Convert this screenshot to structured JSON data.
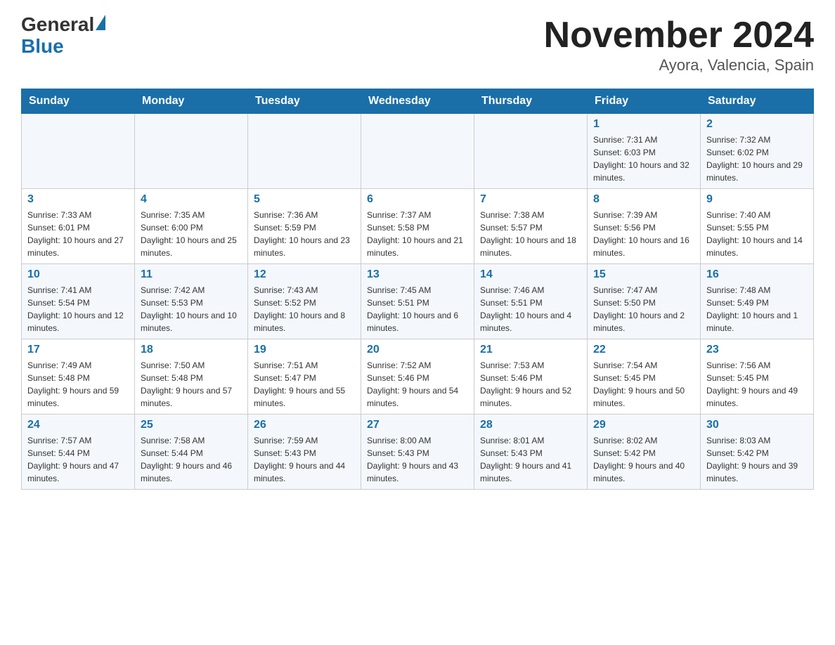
{
  "header": {
    "logo_general": "General",
    "logo_blue": "Blue",
    "title": "November 2024",
    "location": "Ayora, Valencia, Spain"
  },
  "days_of_week": [
    "Sunday",
    "Monday",
    "Tuesday",
    "Wednesday",
    "Thursday",
    "Friday",
    "Saturday"
  ],
  "weeks": [
    [
      {
        "day": "",
        "info": ""
      },
      {
        "day": "",
        "info": ""
      },
      {
        "day": "",
        "info": ""
      },
      {
        "day": "",
        "info": ""
      },
      {
        "day": "",
        "info": ""
      },
      {
        "day": "1",
        "info": "Sunrise: 7:31 AM\nSunset: 6:03 PM\nDaylight: 10 hours and 32 minutes."
      },
      {
        "day": "2",
        "info": "Sunrise: 7:32 AM\nSunset: 6:02 PM\nDaylight: 10 hours and 29 minutes."
      }
    ],
    [
      {
        "day": "3",
        "info": "Sunrise: 7:33 AM\nSunset: 6:01 PM\nDaylight: 10 hours and 27 minutes."
      },
      {
        "day": "4",
        "info": "Sunrise: 7:35 AM\nSunset: 6:00 PM\nDaylight: 10 hours and 25 minutes."
      },
      {
        "day": "5",
        "info": "Sunrise: 7:36 AM\nSunset: 5:59 PM\nDaylight: 10 hours and 23 minutes."
      },
      {
        "day": "6",
        "info": "Sunrise: 7:37 AM\nSunset: 5:58 PM\nDaylight: 10 hours and 21 minutes."
      },
      {
        "day": "7",
        "info": "Sunrise: 7:38 AM\nSunset: 5:57 PM\nDaylight: 10 hours and 18 minutes."
      },
      {
        "day": "8",
        "info": "Sunrise: 7:39 AM\nSunset: 5:56 PM\nDaylight: 10 hours and 16 minutes."
      },
      {
        "day": "9",
        "info": "Sunrise: 7:40 AM\nSunset: 5:55 PM\nDaylight: 10 hours and 14 minutes."
      }
    ],
    [
      {
        "day": "10",
        "info": "Sunrise: 7:41 AM\nSunset: 5:54 PM\nDaylight: 10 hours and 12 minutes."
      },
      {
        "day": "11",
        "info": "Sunrise: 7:42 AM\nSunset: 5:53 PM\nDaylight: 10 hours and 10 minutes."
      },
      {
        "day": "12",
        "info": "Sunrise: 7:43 AM\nSunset: 5:52 PM\nDaylight: 10 hours and 8 minutes."
      },
      {
        "day": "13",
        "info": "Sunrise: 7:45 AM\nSunset: 5:51 PM\nDaylight: 10 hours and 6 minutes."
      },
      {
        "day": "14",
        "info": "Sunrise: 7:46 AM\nSunset: 5:51 PM\nDaylight: 10 hours and 4 minutes."
      },
      {
        "day": "15",
        "info": "Sunrise: 7:47 AM\nSunset: 5:50 PM\nDaylight: 10 hours and 2 minutes."
      },
      {
        "day": "16",
        "info": "Sunrise: 7:48 AM\nSunset: 5:49 PM\nDaylight: 10 hours and 1 minute."
      }
    ],
    [
      {
        "day": "17",
        "info": "Sunrise: 7:49 AM\nSunset: 5:48 PM\nDaylight: 9 hours and 59 minutes."
      },
      {
        "day": "18",
        "info": "Sunrise: 7:50 AM\nSunset: 5:48 PM\nDaylight: 9 hours and 57 minutes."
      },
      {
        "day": "19",
        "info": "Sunrise: 7:51 AM\nSunset: 5:47 PM\nDaylight: 9 hours and 55 minutes."
      },
      {
        "day": "20",
        "info": "Sunrise: 7:52 AM\nSunset: 5:46 PM\nDaylight: 9 hours and 54 minutes."
      },
      {
        "day": "21",
        "info": "Sunrise: 7:53 AM\nSunset: 5:46 PM\nDaylight: 9 hours and 52 minutes."
      },
      {
        "day": "22",
        "info": "Sunrise: 7:54 AM\nSunset: 5:45 PM\nDaylight: 9 hours and 50 minutes."
      },
      {
        "day": "23",
        "info": "Sunrise: 7:56 AM\nSunset: 5:45 PM\nDaylight: 9 hours and 49 minutes."
      }
    ],
    [
      {
        "day": "24",
        "info": "Sunrise: 7:57 AM\nSunset: 5:44 PM\nDaylight: 9 hours and 47 minutes."
      },
      {
        "day": "25",
        "info": "Sunrise: 7:58 AM\nSunset: 5:44 PM\nDaylight: 9 hours and 46 minutes."
      },
      {
        "day": "26",
        "info": "Sunrise: 7:59 AM\nSunset: 5:43 PM\nDaylight: 9 hours and 44 minutes."
      },
      {
        "day": "27",
        "info": "Sunrise: 8:00 AM\nSunset: 5:43 PM\nDaylight: 9 hours and 43 minutes."
      },
      {
        "day": "28",
        "info": "Sunrise: 8:01 AM\nSunset: 5:43 PM\nDaylight: 9 hours and 41 minutes."
      },
      {
        "day": "29",
        "info": "Sunrise: 8:02 AM\nSunset: 5:42 PM\nDaylight: 9 hours and 40 minutes."
      },
      {
        "day": "30",
        "info": "Sunrise: 8:03 AM\nSunset: 5:42 PM\nDaylight: 9 hours and 39 minutes."
      }
    ]
  ]
}
